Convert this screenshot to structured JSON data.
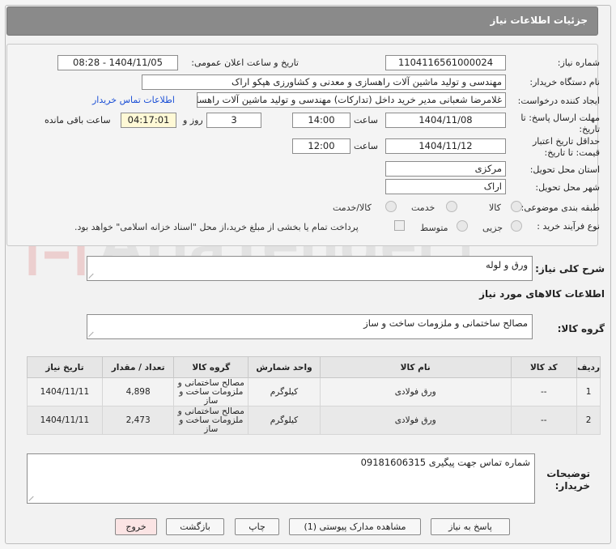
{
  "header": {
    "title": "جزئیات اطلاعات نیاز"
  },
  "form": {
    "need_number": {
      "label": "شماره نیاز:",
      "value": "1104116561000024"
    },
    "announce": {
      "label": "تاریخ و ساعت اعلان عمومی:",
      "value": "1404/11/05 - 08:28"
    },
    "buyer_org": {
      "label": "نام دستگاه خریدار:",
      "value": "مهندسی و تولید ماشین آلات راهسازی و معدنی و کشاورزی هپکو اراک"
    },
    "requester": {
      "label": "ایجاد کننده درخواست:",
      "value": "غلامرضا شعبانی مدیر خرید داخل (تدارکات) مهندسی و تولید ماشین آلات راهسا",
      "link": "اطلاعات تماس خریدار"
    },
    "deadline": {
      "label_line1": "مهلت ارسال پاسخ: تا",
      "label_line2": "تاریخ:",
      "date": "1404/11/08",
      "time_label": "ساعت",
      "time": "14:00",
      "days": "3",
      "days_label": "روز و",
      "remaining": "04:17:01",
      "remaining_label": "ساعت باقی مانده"
    },
    "validity": {
      "label_line1": "حداقل تاریخ اعتبار",
      "label_line2": "قیمت: تا تاریخ:",
      "date": "1404/11/12",
      "time_label": "ساعت",
      "time": "12:00"
    },
    "province": {
      "label": "استان محل تحویل:",
      "value": "مرکزی"
    },
    "city": {
      "label": "شهر محل تحویل:",
      "value": "اراک"
    },
    "category": {
      "label": "طبقه بندی موضوعی:",
      "options": [
        "کالا",
        "خدمت",
        "کالا/خدمت"
      ]
    },
    "process": {
      "label": "نوع فرآیند خرید :",
      "options": [
        "جزیی",
        "متوسط"
      ],
      "note": "پرداخت تمام یا بخشی از مبلغ خرید،از محل \"اسناد خزانه اسلامی\" خواهد بود."
    }
  },
  "description": {
    "label": "شرح کلی نیاز:",
    "value": "ورق و لوله"
  },
  "goods_info": {
    "title": "اطلاعات کالاهای مورد نیاز"
  },
  "goods_group": {
    "label": "گروه کالا:",
    "value": "مصالح ساختمانی و ملزومات ساخت و ساز"
  },
  "table": {
    "headers": [
      "ردیف",
      "کد کالا",
      "نام کالا",
      "واحد شمارش",
      "گروه کالا",
      "تعداد / مقدار",
      "تاریخ نیاز"
    ],
    "rows": [
      {
        "row": "1",
        "code": "--",
        "name": "ورق فولادی",
        "unit": "کیلوگرم",
        "group": "مصالح ساختمانی و ملزومات ساخت و ساز",
        "qty": "4,898",
        "date": "1404/11/11"
      },
      {
        "row": "2",
        "code": "--",
        "name": "ورق فولادی",
        "unit": "کیلوگرم",
        "group": "مصالح ساختمانی و ملزومات ساخت و ساز",
        "qty": "2,473",
        "date": "1404/11/11"
      }
    ]
  },
  "buyer_notes": {
    "label_line1": "توضیحات",
    "label_line2": "خریدار:",
    "value": "شماره تماس جهت پیگیری 09181606315"
  },
  "buttons": {
    "reply": "پاسخ به نیاز",
    "attachments": "مشاهده مدارک پیوستی (1)",
    "print": "چاپ",
    "back": "بازگشت",
    "exit": "خروج"
  },
  "watermark": {
    "text": "AriaTender.net"
  },
  "colors": {
    "header_bg": "#8a8a8a",
    "link": "#1b4fd6",
    "remaining_bg": "#fff9d6",
    "exit_bg": "#fbe4e4"
  }
}
